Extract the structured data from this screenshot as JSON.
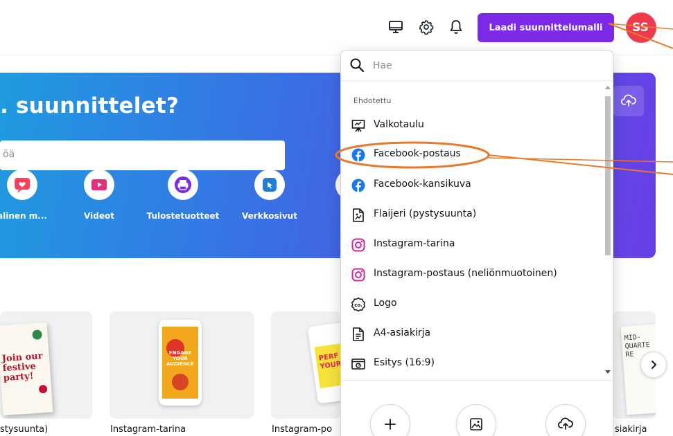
{
  "topbar": {
    "create_button": "Laadi suunnittelumalli",
    "avatar_initials": "SS"
  },
  "hero": {
    "title": ". suunnittelet?",
    "search_placeholder": "öä",
    "categories": [
      {
        "label": "alinen m..."
      },
      {
        "label": "Videot"
      },
      {
        "label": "Tulostetuotteet"
      },
      {
        "label": "Verkkosivut"
      }
    ]
  },
  "templates": {
    "cards": [
      {
        "label": "stysuunta)",
        "art": "Join our festive party!"
      },
      {
        "label": "Instagram-tarina",
        "art": "ENGAGE YOUR AUDIENCE"
      },
      {
        "label": "Instagram-po",
        "art": "PERF YOUR"
      },
      {
        "label": "siakirja",
        "art": "MID- QUARTE RE"
      }
    ]
  },
  "dropdown": {
    "search_placeholder": "Hae",
    "section_title": "Ehdotettu",
    "items": [
      {
        "label": "Valkotaulu",
        "icon": "whiteboard-icon"
      },
      {
        "label": "Facebook-postaus",
        "icon": "facebook-icon"
      },
      {
        "label": "Facebook-kansikuva",
        "icon": "facebook-icon"
      },
      {
        "label": "Flaijeri (pystysuunta)",
        "icon": "flyer-icon"
      },
      {
        "label": "Instagram-tarina",
        "icon": "instagram-icon"
      },
      {
        "label": "Instagram-postaus (neliönmuotoinen)",
        "icon": "instagram-icon"
      },
      {
        "label": "Logo",
        "icon": "logo-icon"
      },
      {
        "label": "A4-asiakirja",
        "icon": "document-icon"
      },
      {
        "label": "Esitys (16:9)",
        "icon": "presentation-icon"
      }
    ]
  },
  "colors": {
    "accent": "#7d2ae8",
    "annotation": "#e8782a",
    "facebook": "#1877f2",
    "instagram": "#d6249f"
  }
}
